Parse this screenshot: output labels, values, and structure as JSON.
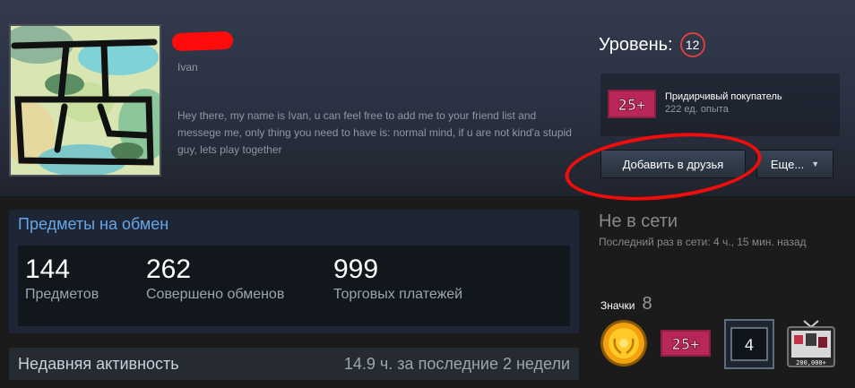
{
  "profile": {
    "real_name": "Ivan",
    "summary": "Hey there, my name is Ivan, u can feel free to add me to your friend list and messege me, only thing you need to have is: normal mind, if u are not kind'a stupid guy, lets play together"
  },
  "level": {
    "label": "Уровень:",
    "value": "12"
  },
  "favorite_badge": {
    "icon_text": "25+",
    "title": "Придирчивый покупатель",
    "xp": "222 ед. опыта"
  },
  "actions": {
    "add_friend": "Добавить в друзья",
    "more": "Еще...",
    "more_caret": "▼"
  },
  "trade": {
    "title": "Предметы на обмен",
    "stats": [
      {
        "value": "144",
        "label": "Предметов"
      },
      {
        "value": "262",
        "label": "Совершено обменов"
      },
      {
        "value": "999",
        "label": "Торговых платежей"
      }
    ]
  },
  "activity": {
    "title": "Недавняя активность",
    "hours": "14.9 ч. за последние 2 недели"
  },
  "status": {
    "state": "Не в сети",
    "last_online": "Последний раз в сети: 4 ч., 15 мин. назад"
  },
  "badges": {
    "label": "Значки",
    "count": "8",
    "items": [
      {
        "icon": "gold-laurel-coin-icon"
      },
      {
        "icon": "25-plus-badge-icon",
        "text": "25+"
      },
      {
        "icon": "level-4-badge-icon",
        "text": "4"
      },
      {
        "icon": "retro-tv-badge-icon",
        "text": "200,000+"
      }
    ]
  },
  "colors": {
    "accent_blue": "#66a6e6",
    "level_ring": "#d64043",
    "annotation_red": "#f30c0c"
  }
}
